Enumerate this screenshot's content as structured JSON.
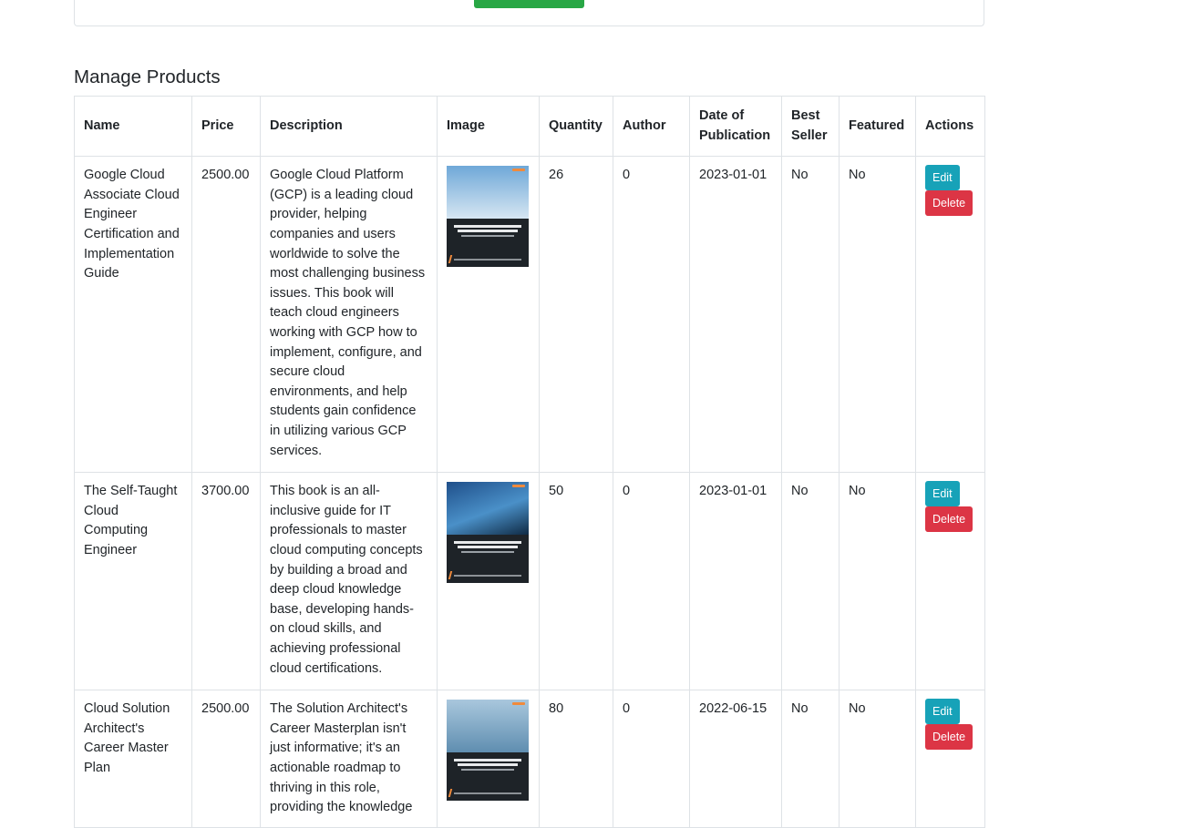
{
  "section_title": "Manage Products",
  "colors": {
    "submit": "#28a745",
    "edit": "#17a2b8",
    "delete": "#dc3545"
  },
  "table": {
    "headers": {
      "name": "Name",
      "price": "Price",
      "description": "Description",
      "image": "Image",
      "quantity": "Quantity",
      "author": "Author",
      "date": "Date of Publication",
      "best_seller": "Best Seller",
      "featured": "Featured",
      "actions": "Actions"
    },
    "rows": [
      {
        "name": "Google Cloud Associate Cloud Engineer Certification and Implementation Guide",
        "price": "2500.00",
        "description": "Google Cloud Platform (GCP) is a leading cloud provider, helping companies and users worldwide to solve the most challenging business issues. This book will teach cloud engineers working with GCP how to implement, configure, and secure cloud environments, and help students gain confidence in utilizing various GCP services.",
        "image_alt": "Google Cloud Associate Cloud Engineer Certification and Implementation Guide",
        "quantity": "26",
        "author": "0",
        "date": "2023-01-01",
        "best_seller": "No",
        "featured": "No",
        "edit_label": "Edit",
        "delete_label": "Delete"
      },
      {
        "name": "The Self-Taught Cloud Computing Engineer",
        "price": "3700.00",
        "description": "This book is an all-inclusive guide for IT professionals to master cloud computing concepts by building a broad and deep cloud knowledge base, developing hands-on cloud skills, and achieving professional cloud certifications.",
        "image_alt": "The Self-Taught Cloud Computing Engineer",
        "quantity": "50",
        "author": "0",
        "date": "2023-01-01",
        "best_seller": "No",
        "featured": "No",
        "edit_label": "Edit",
        "delete_label": "Delete"
      },
      {
        "name": "Cloud Solution Architect's Career Master Plan",
        "price": "2500.00",
        "description": "The Solution Architect's Career Masterplan isn't just informative; it's an actionable roadmap to thriving in this role, providing the knowledge",
        "image_alt": "Cloud Solution Architect's Career Master Plan",
        "quantity": "80",
        "author": "0",
        "date": "2022-06-15",
        "best_seller": "No",
        "featured": "No",
        "edit_label": "Edit",
        "delete_label": "Delete"
      }
    ]
  }
}
